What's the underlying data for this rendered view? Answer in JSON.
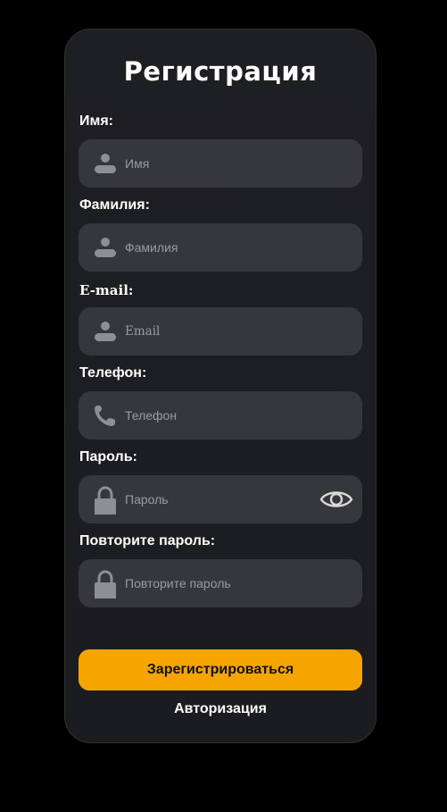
{
  "form": {
    "title": "Регистрация",
    "fields": [
      {
        "label": "Имя:",
        "placeholder": "Имя",
        "icon": "user-icon",
        "value": ""
      },
      {
        "label": "Фамилия:",
        "placeholder": "Фамилия",
        "icon": "user-icon",
        "value": ""
      },
      {
        "label": "E-mail:",
        "placeholder": "Email",
        "icon": "user-icon",
        "value": ""
      },
      {
        "label": "Телефон:",
        "placeholder": "Телефон",
        "icon": "phone-icon",
        "value": ""
      },
      {
        "label": "Пароль:",
        "placeholder": "Пароль",
        "icon": "lock-icon",
        "value": "",
        "toggle_icon": "eye-icon"
      },
      {
        "label": "Повторите пароль:",
        "placeholder": "Повторите пароль",
        "icon": "lock-icon",
        "value": ""
      }
    ],
    "submit_label": "Зарегистрироваться",
    "login_link": "Авторизация"
  },
  "colors": {
    "page_background": "#000000",
    "card_background": "#1d1e22",
    "field_background": "#36373b",
    "icon_color": "#8e8f94",
    "accent": "#f6a500",
    "text": "#ffffff"
  }
}
